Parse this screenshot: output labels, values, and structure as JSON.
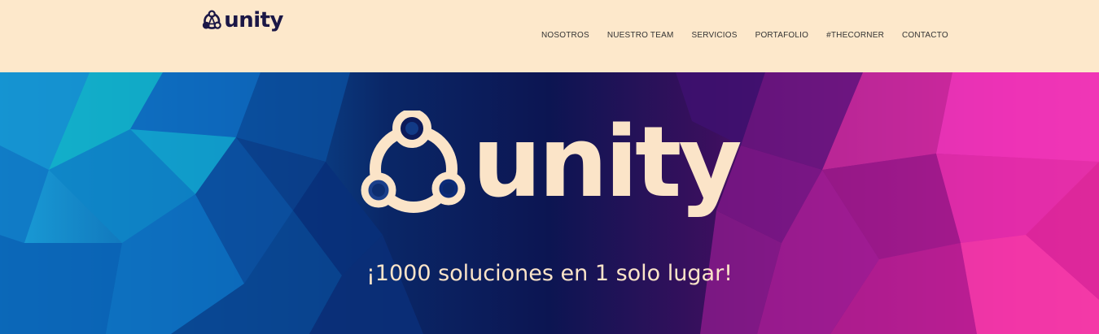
{
  "header": {
    "logo_text": "unity",
    "nav": [
      "NOSOTROS",
      "NUESTRO TEAM",
      "SERVICIOS",
      "PORTAFOLIO",
      "#THECORNER",
      "CONTACTO"
    ]
  },
  "hero": {
    "logo_text": "unity",
    "tagline": "¡1000 soluciones en 1 solo lugar!"
  },
  "colors": {
    "header_bg": "#fde8cb",
    "logo_dark": "#1b1746",
    "hero_text": "#fbe4c8",
    "left_accent": "#1aa0d9",
    "right_accent": "#f43aa8"
  }
}
